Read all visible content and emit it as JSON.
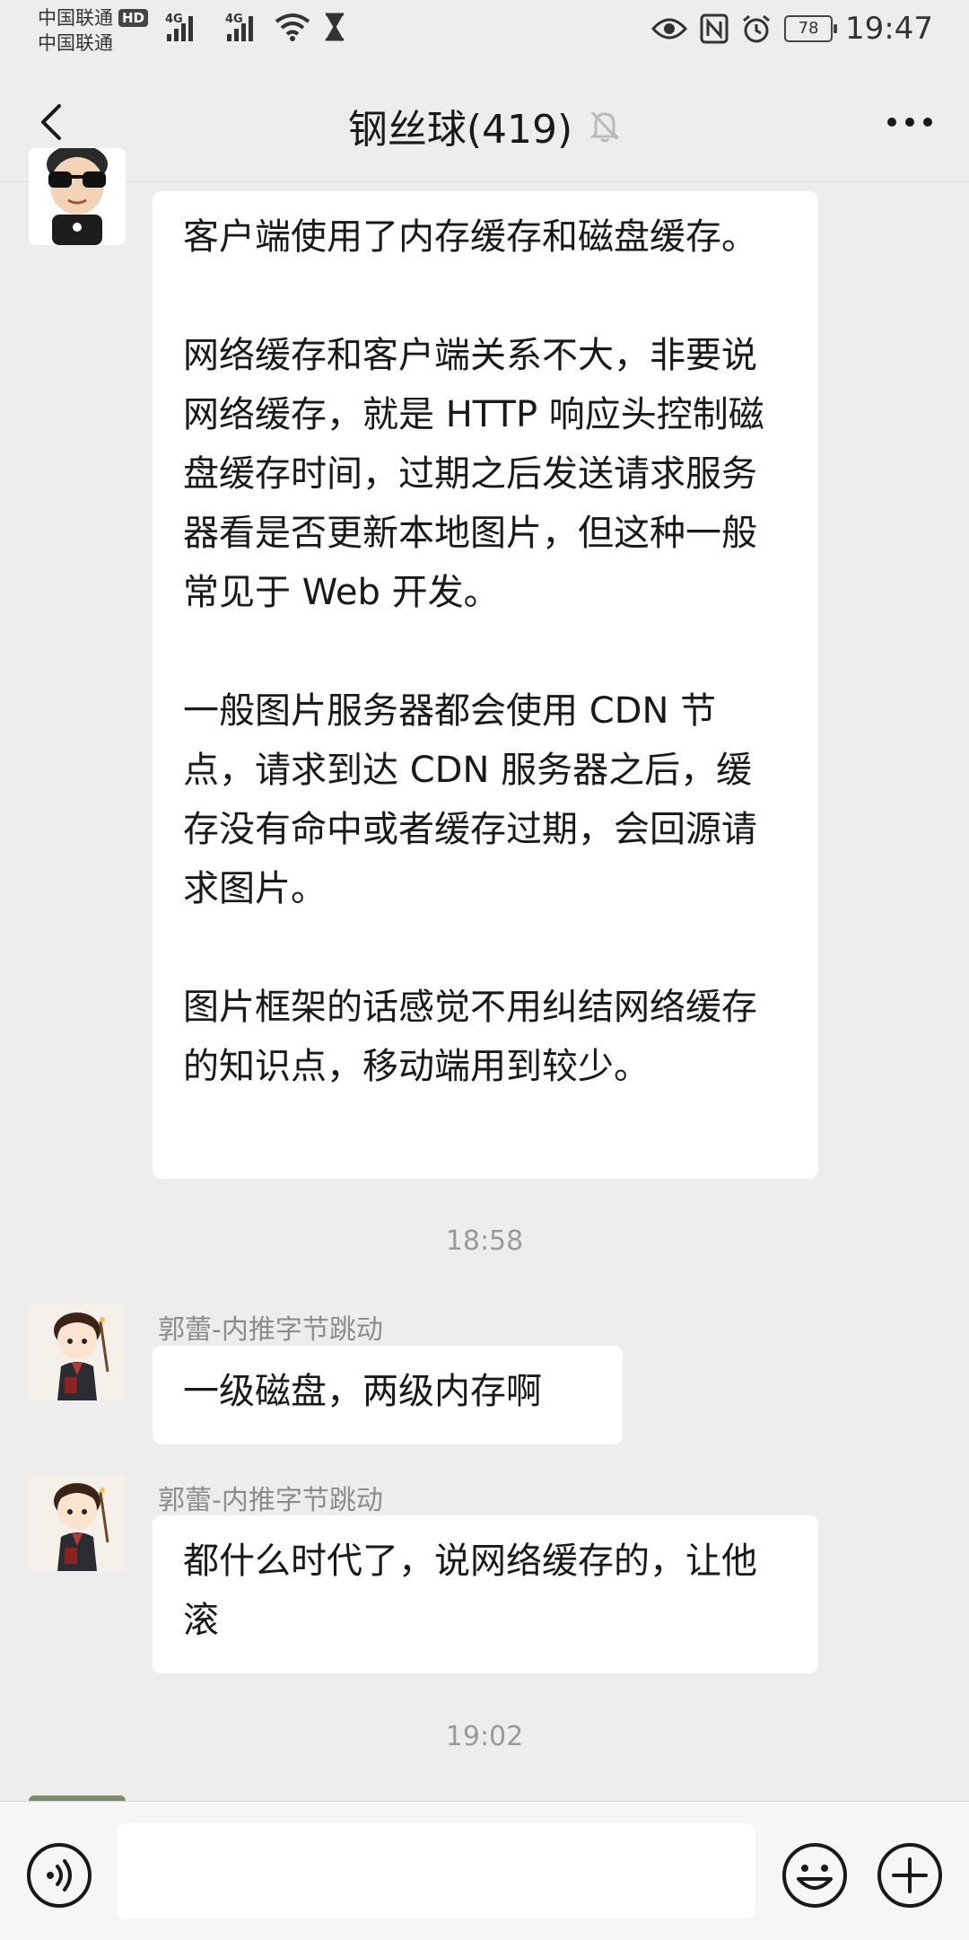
{
  "status_bar": {
    "carrier_1": "中国联通",
    "carrier_2": "中国联通",
    "hd_badge": "HD",
    "network_1": "4G",
    "network_2": "4G",
    "battery": "78",
    "time": "19:47"
  },
  "header": {
    "title": "钢丝球(419)",
    "icons": [
      "back-arrow-icon",
      "mute-bell-icon",
      "more-icon"
    ]
  },
  "messages": [
    {
      "paragraphs": [
        "客户端使用了内存缓存和磁盘缓存。",
        "网络缓存和客户端关系不大，非要说网络缓存，就是 HTTP 响应头控制磁盘缓存时间，过期之后发送请求服务器看是否更新本地图片，但这种一般常见于 Web 开发。",
        "一般图片服务器都会使用 CDN 节点，请求到达 CDN 服务器之后，缓存没有命中或者缓存过期，会回源请求图片。",
        "图片框架的话感觉不用纠结网络缓存的知识点，移动端用到较少。"
      ]
    },
    {
      "timestamp": "18:58"
    },
    {
      "sender": "郭蕾-内推字节跳动",
      "text": "一级磁盘，两级内存啊"
    },
    {
      "sender": "郭蕾-内推字节跳动",
      "text": "都什么时代了，说网络缓存的，让他滚"
    },
    {
      "timestamp": "19:02"
    }
  ],
  "input_bar": {
    "value": "",
    "icons": [
      "voice-icon",
      "emoji-icon",
      "plus-icon"
    ]
  },
  "colors": {
    "background": "#ededed",
    "bubble": "#ffffff",
    "text": "#191919",
    "secondary_text": "#8c8c8c"
  }
}
